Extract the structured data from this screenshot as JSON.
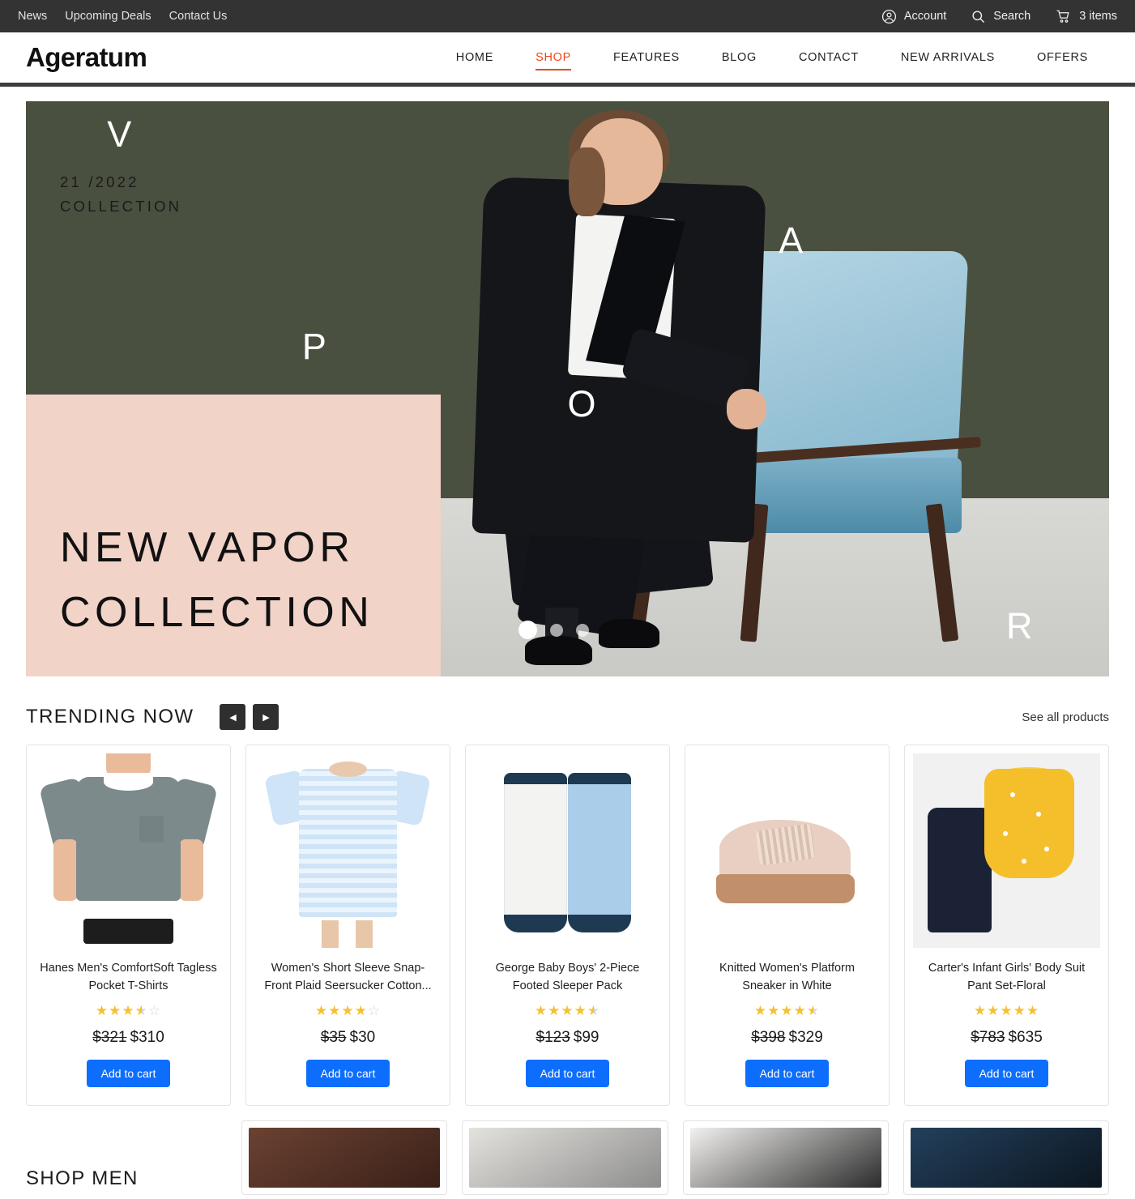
{
  "topbar": {
    "links": [
      "News",
      "Upcoming Deals",
      "Contact Us"
    ],
    "account_label": "Account",
    "search_label": "Search",
    "cart_label": "3 items"
  },
  "header": {
    "logo": "Ageratum",
    "nav": [
      {
        "label": "HOME",
        "active": false
      },
      {
        "label": "SHOP",
        "active": true
      },
      {
        "label": "FEATURES",
        "active": false
      },
      {
        "label": "BLOG",
        "active": false
      },
      {
        "label": "CONTACT",
        "active": false
      },
      {
        "label": "NEW ARRIVALS",
        "active": false
      },
      {
        "label": "OFFERS",
        "active": false
      }
    ],
    "accent_color": "#e8491d"
  },
  "hero": {
    "kicker_line1": "21 /2022",
    "kicker_line2": "COLLECTION",
    "title_line1": "NEW VAPOR",
    "title_line2": "COLLECTION",
    "letters": [
      "V",
      "A",
      "P",
      "O",
      "R"
    ],
    "background_color": "#4a5040",
    "card_color": "#f2d3c8",
    "slides": 3,
    "active_slide": 1
  },
  "trending": {
    "title": "TRENDING NOW",
    "prev_icon": "chevron-left-icon",
    "next_icon": "chevron-right-icon",
    "see_all": "See all products"
  },
  "products": [
    {
      "name": "Hanes Men's ComfortSoft Tagless Pocket T-Shirts",
      "rating": 3.5,
      "old_price": "$321",
      "price": "$310",
      "cta": "Add to cart"
    },
    {
      "name": "Women's Short Sleeve Snap-Front Plaid Seersucker Cotton...",
      "rating": 4,
      "old_price": "$35",
      "price": "$30",
      "cta": "Add to cart"
    },
    {
      "name": "George Baby Boys' 2-Piece Footed Sleeper Pack",
      "rating": 4.5,
      "old_price": "$123",
      "price": "$99",
      "cta": "Add to cart"
    },
    {
      "name": "Knitted Women's Platform Sneaker in White",
      "rating": 4.5,
      "old_price": "$398",
      "price": "$329",
      "cta": "Add to cart"
    },
    {
      "name": "Carter's Infant Girls' Body Suit Pant Set-Floral",
      "rating": 5,
      "old_price": "$783",
      "price": "$635",
      "cta": "Add to cart"
    }
  ],
  "bottom": {
    "title": "SHOP MEN"
  },
  "colors": {
    "cart_button": "#0d6efd",
    "star": "#f5c033",
    "topbar": "#333333"
  }
}
